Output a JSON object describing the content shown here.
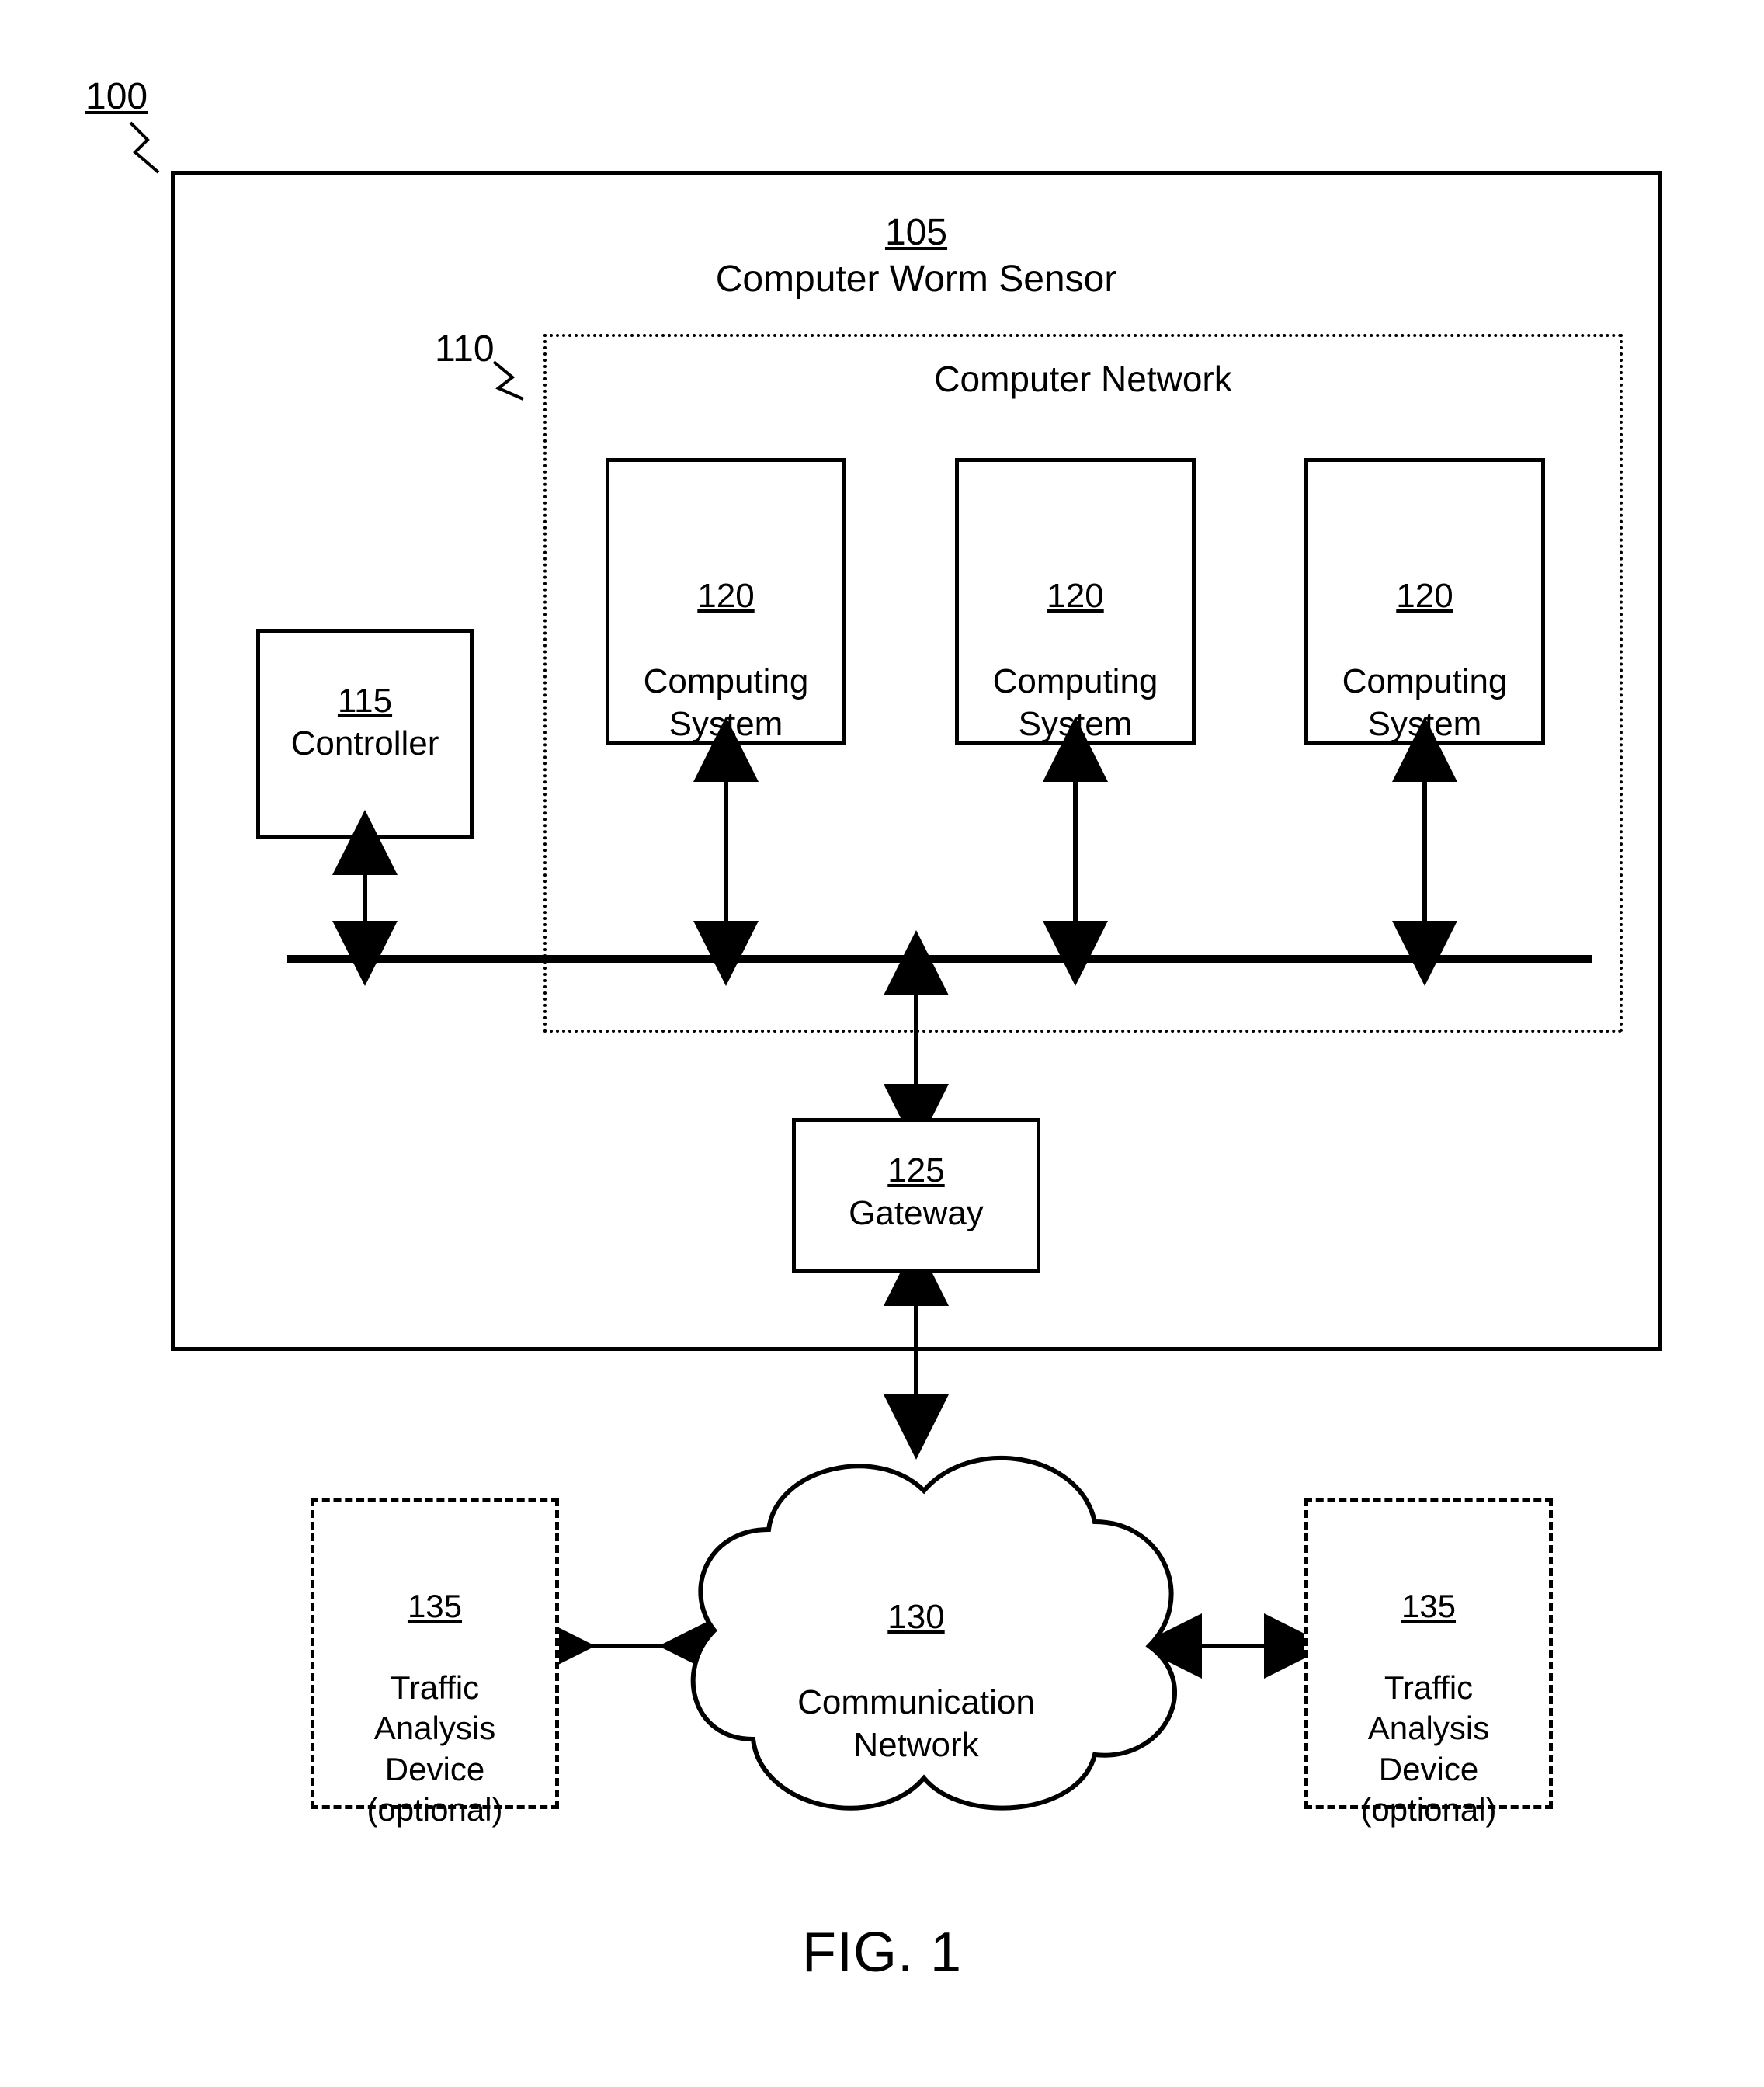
{
  "figure": {
    "caption": "FIG. 1",
    "overall_ref": "100"
  },
  "sensor": {
    "ref": "105",
    "label": "Computer Worm Sensor"
  },
  "controller": {
    "ref": "115",
    "label": "Controller"
  },
  "network": {
    "ref": "110",
    "label": "Computer Network"
  },
  "computing_systems": [
    {
      "ref": "120",
      "label": "Computing\nSystem"
    },
    {
      "ref": "120",
      "label": "Computing\nSystem"
    },
    {
      "ref": "120",
      "label": "Computing\nSystem"
    }
  ],
  "gateway": {
    "ref": "125",
    "label": "Gateway"
  },
  "comm_network": {
    "ref": "130",
    "label": "Communication\nNetwork"
  },
  "traffic_devices": [
    {
      "ref": "135",
      "label": "Traffic\nAnalysis\nDevice\n(optional)"
    },
    {
      "ref": "135",
      "label": "Traffic\nAnalysis\nDevice\n(optional)"
    }
  ]
}
